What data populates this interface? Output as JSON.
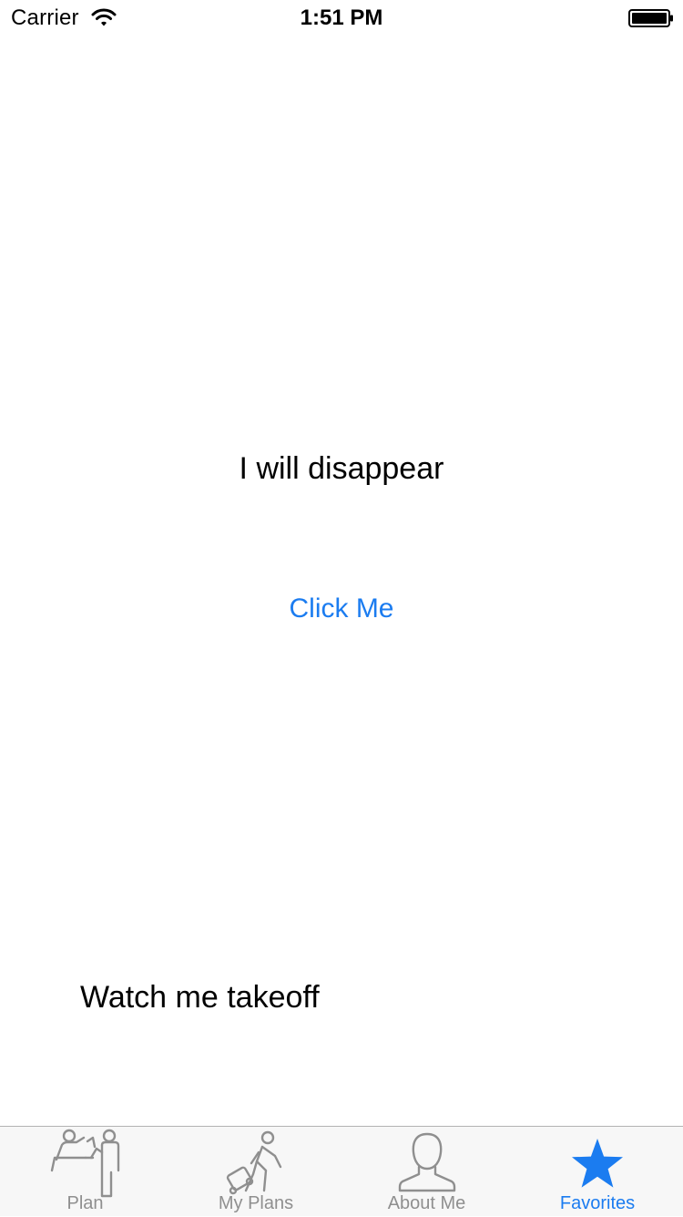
{
  "status_bar": {
    "carrier": "Carrier",
    "time": "1:51 PM",
    "wifi_icon": "wifi-icon",
    "battery_icon": "battery-icon",
    "battery_level": 1.0
  },
  "main": {
    "disappear_label": "I will disappear",
    "click_button": "Click Me",
    "takeoff_label": "Watch me takeoff"
  },
  "tab_bar": {
    "tabs": [
      {
        "label": "Plan",
        "icon": "meeting-people-icon",
        "active": false
      },
      {
        "label": "My Plans",
        "icon": "traveler-luggage-icon",
        "active": false
      },
      {
        "label": "About Me",
        "icon": "user-silhouette-icon",
        "active": false
      },
      {
        "label": "Favorites",
        "icon": "star-icon",
        "active": true
      }
    ]
  },
  "colors": {
    "accent": "#1b7cf0",
    "inactive": "#8f8f8f",
    "tab_bar_bg": "#f7f7f7"
  }
}
